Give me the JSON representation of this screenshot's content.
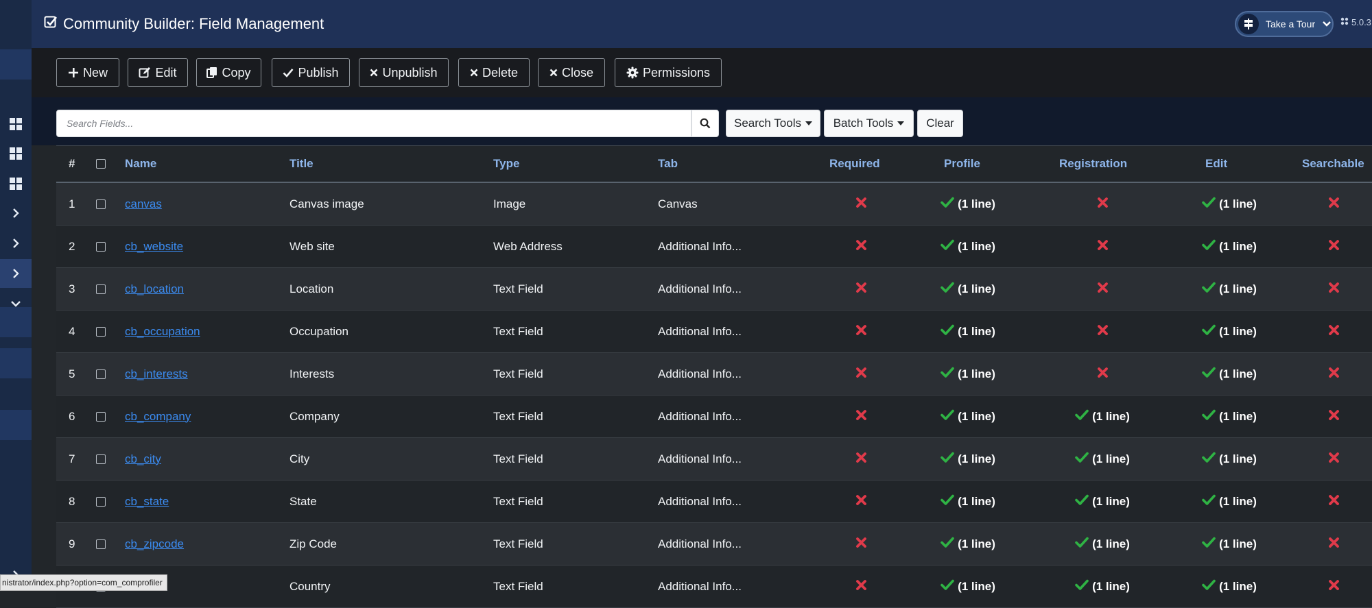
{
  "header": {
    "title": "Community Builder: Field Management",
    "tour_label": "Take a Tour",
    "version": "5.0.3"
  },
  "toolbar": [
    {
      "key": "new",
      "label": "New",
      "icon": "plus-icon"
    },
    {
      "key": "edit",
      "label": "Edit",
      "icon": "edit-icon"
    },
    {
      "key": "copy",
      "label": "Copy",
      "icon": "copy-icon"
    },
    {
      "key": "publish",
      "label": "Publish",
      "icon": "check-icon"
    },
    {
      "key": "unpublish",
      "label": "Unpublish",
      "icon": "times-icon"
    },
    {
      "key": "delete",
      "label": "Delete",
      "icon": "times-icon"
    },
    {
      "key": "close",
      "label": "Close",
      "icon": "times-icon"
    },
    {
      "key": "permissions",
      "label": "Permissions",
      "icon": "gear-icon"
    }
  ],
  "search": {
    "placeholder": "Search Fields...",
    "search_tools": "Search Tools",
    "batch_tools": "Batch Tools",
    "clear": "Clear"
  },
  "table": {
    "columns": {
      "hash": "#",
      "name": "Name",
      "title": "Title",
      "type": "Type",
      "tab": "Tab",
      "required": "Required",
      "profile": "Profile",
      "registration": "Registration",
      "edit": "Edit",
      "searchable": "Searchable"
    },
    "status_text": "(1 line)",
    "rows": [
      {
        "num": "1",
        "name": "canvas",
        "title": "Canvas image",
        "type": "Image",
        "tab": "Canvas",
        "required": false,
        "profile": true,
        "registration": false,
        "edit": true,
        "searchable": false
      },
      {
        "num": "2",
        "name": "cb_website",
        "title": "Web site",
        "type": "Web Address",
        "tab": "Additional Info...",
        "required": false,
        "profile": true,
        "registration": false,
        "edit": true,
        "searchable": false
      },
      {
        "num": "3",
        "name": "cb_location",
        "title": "Location",
        "type": "Text Field",
        "tab": "Additional Info...",
        "required": false,
        "profile": true,
        "registration": false,
        "edit": true,
        "searchable": false
      },
      {
        "num": "4",
        "name": "cb_occupation",
        "title": "Occupation",
        "type": "Text Field",
        "tab": "Additional Info...",
        "required": false,
        "profile": true,
        "registration": false,
        "edit": true,
        "searchable": false
      },
      {
        "num": "5",
        "name": "cb_interests",
        "title": "Interests",
        "type": "Text Field",
        "tab": "Additional Info...",
        "required": false,
        "profile": true,
        "registration": false,
        "edit": true,
        "searchable": false
      },
      {
        "num": "6",
        "name": "cb_company",
        "title": "Company",
        "type": "Text Field",
        "tab": "Additional Info...",
        "required": false,
        "profile": true,
        "registration": true,
        "edit": true,
        "searchable": false
      },
      {
        "num": "7",
        "name": "cb_city",
        "title": "City",
        "type": "Text Field",
        "tab": "Additional Info...",
        "required": false,
        "profile": true,
        "registration": true,
        "edit": true,
        "searchable": false
      },
      {
        "num": "8",
        "name": "cb_state",
        "title": "State",
        "type": "Text Field",
        "tab": "Additional Info...",
        "required": false,
        "profile": true,
        "registration": true,
        "edit": true,
        "searchable": false
      },
      {
        "num": "9",
        "name": "cb_zipcode",
        "title": "Zip Code",
        "type": "Text Field",
        "tab": "Additional Info...",
        "required": false,
        "profile": true,
        "registration": true,
        "edit": true,
        "searchable": false
      },
      {
        "num": "",
        "name": "",
        "title": "Country",
        "type": "Text Field",
        "tab": "Additional Info...",
        "required": false,
        "profile": true,
        "registration": true,
        "edit": true,
        "searchable": false
      }
    ]
  },
  "status_bar": {
    "url": "nistrator/index.php?option=com_comprofiler"
  },
  "colors": {
    "check": "#2fb344",
    "cross": "#e03a4a",
    "link": "#3b8bf0",
    "header_bg": "#1f3157",
    "sidebar_bg": "#1a2a46"
  }
}
